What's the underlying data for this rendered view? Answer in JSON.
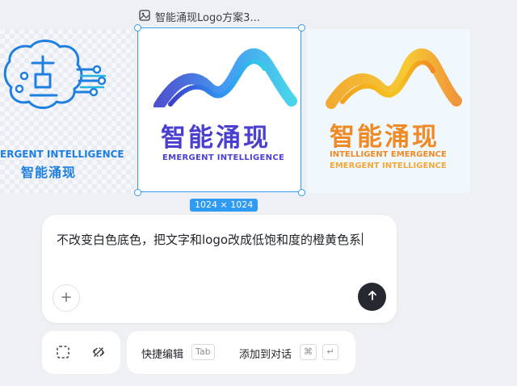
{
  "file": {
    "name": "智能涌现Logo方案3...",
    "icon": "image-icon",
    "dimensions": "1024 × 1024"
  },
  "thumbnails": {
    "left": {
      "title_en": "ERGENT INTELLIGENCE",
      "title_cn": "智能涌现",
      "icon": "brain-circuit-icon",
      "accent": "#1e7fe0"
    },
    "middle": {
      "title_cn": "智能涌现",
      "title_en": "EMERGENT INTELLIGENCE",
      "icon": "dotted-wave-icon",
      "accent": "#4b3fd0"
    },
    "right": {
      "title_cn": "智能涌现",
      "line1": "INTELLIGENT EMERGENCE",
      "line2": "EMERGENT INTELLIGENCE",
      "icon": "dotted-wave-icon",
      "accent": "#f08a24"
    }
  },
  "prompt": {
    "text": "不改变白色底色，把文字和logo改成低饱和度的橙黄色系"
  },
  "toolbar": {
    "quick_edit_label": "快捷编辑",
    "quick_edit_key": "Tab",
    "add_to_chat_label": "添加到对话",
    "cmd_key": "⌘",
    "enter_key": "↵"
  },
  "colors": {
    "selection": "#2f9bf3",
    "send_button": "#262a30",
    "background": "#eef0f3"
  }
}
